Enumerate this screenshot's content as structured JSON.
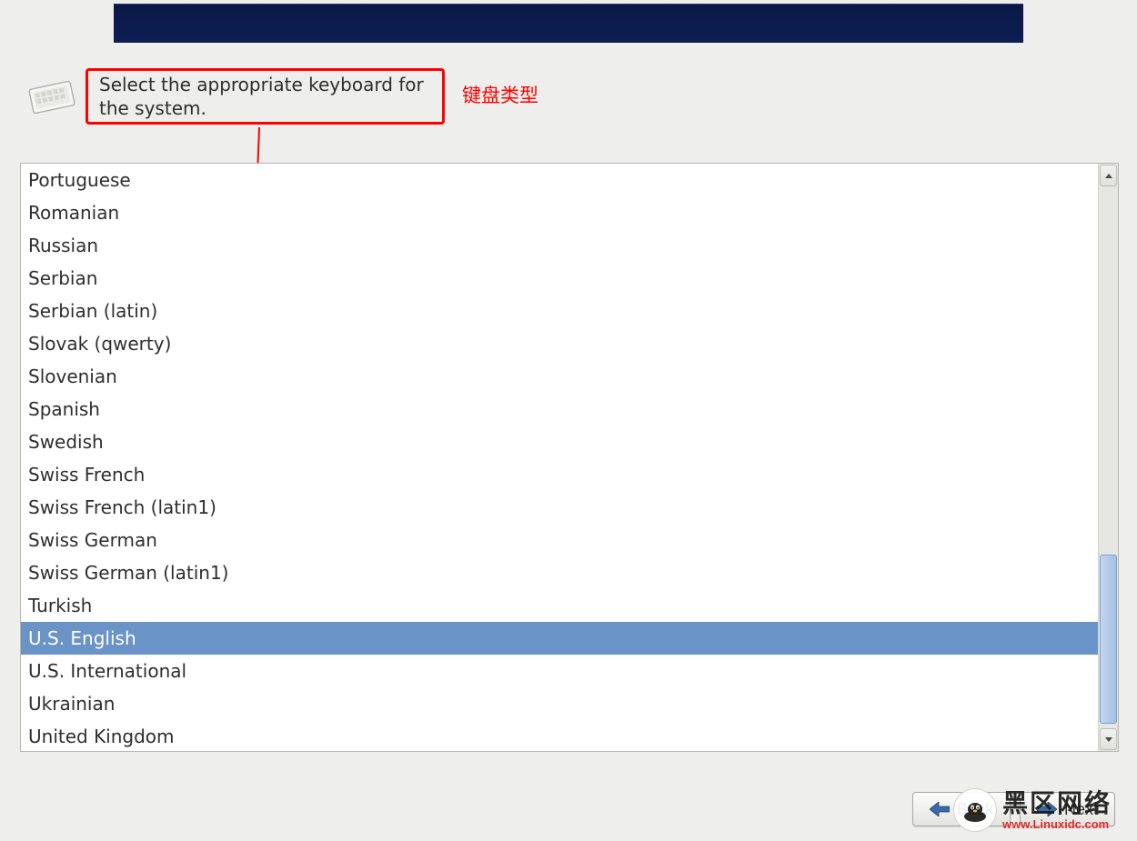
{
  "instruction": "Select the appropriate keyboard for the system.",
  "annotation": "键盘类型",
  "keyboard_list": {
    "items": [
      "Portuguese",
      "Romanian",
      "Russian",
      "Serbian",
      "Serbian (latin)",
      "Slovak (qwerty)",
      "Slovenian",
      "Spanish",
      "Swedish",
      "Swiss French",
      "Swiss French (latin1)",
      "Swiss German",
      "Swiss German (latin1)",
      "Turkish",
      "U.S. English",
      "U.S. International",
      "Ukrainian",
      "United Kingdom"
    ],
    "selected_index": 14
  },
  "buttons": {
    "back": "Back",
    "next": "Next"
  },
  "watermark": {
    "brand": "黑区网络",
    "url": "www.Linuxidc.com"
  },
  "scrollbar": {
    "thumb_start_pct": 68,
    "thumb_height_pct": 31
  }
}
